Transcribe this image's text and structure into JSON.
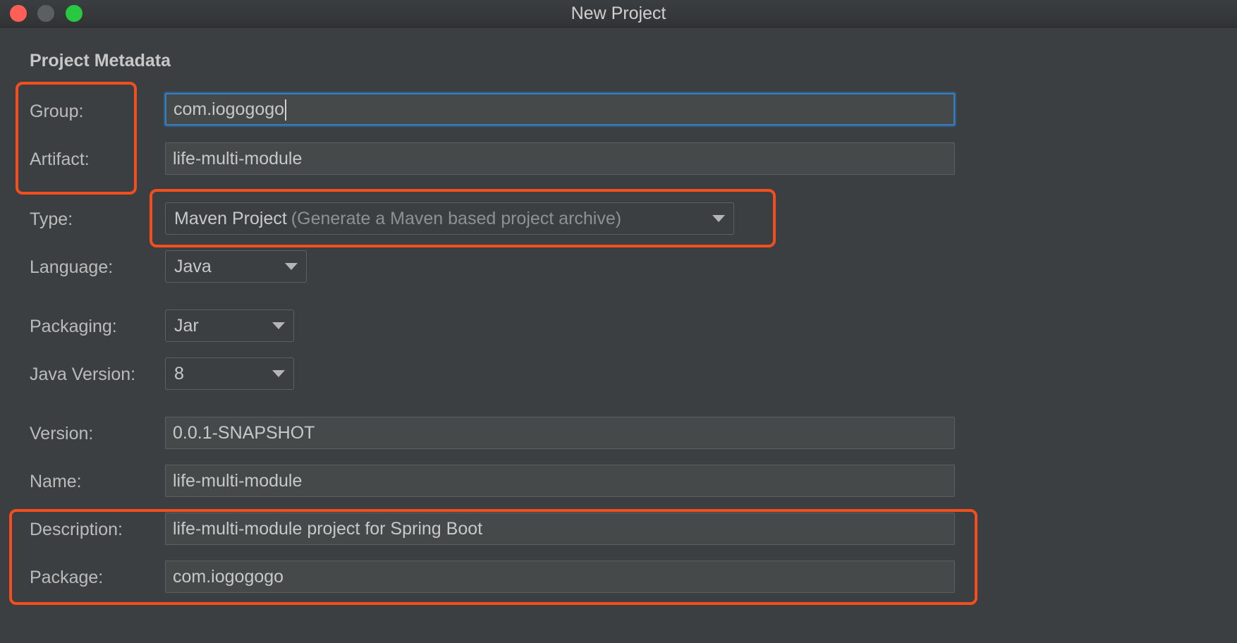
{
  "window": {
    "title": "New Project"
  },
  "section": {
    "title": "Project Metadata"
  },
  "fields": {
    "group": {
      "label": "Group:",
      "value": "com.iogogogo"
    },
    "artifact": {
      "label": "Artifact:",
      "value": "life-multi-module"
    },
    "type": {
      "label": "Type:",
      "value": "Maven Project",
      "hint": "(Generate a Maven based project archive)"
    },
    "language": {
      "label": "Language:",
      "value": "Java"
    },
    "packaging": {
      "label": "Packaging:",
      "value": "Jar"
    },
    "java_version": {
      "label": "Java Version:",
      "value": "8"
    },
    "version": {
      "label": "Version:",
      "value": "0.0.1-SNAPSHOT"
    },
    "name": {
      "label": "Name:",
      "value": "life-multi-module"
    },
    "description": {
      "label": "Description:",
      "value": "life-multi-module project for Spring Boot"
    },
    "package": {
      "label": "Package:",
      "value": "com.iogogogo"
    }
  },
  "colors": {
    "background": "#3c3f41",
    "focus_border": "#3d7cb6",
    "highlight": "#f24e1e"
  }
}
